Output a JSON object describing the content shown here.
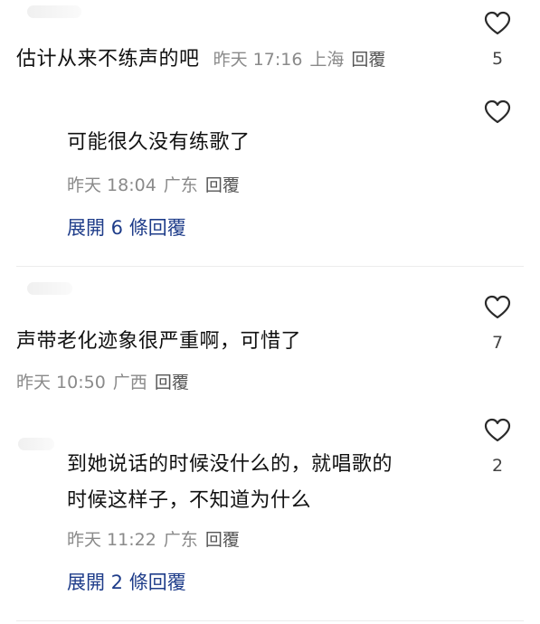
{
  "comments": [
    {
      "text": "估计从来不练声的吧",
      "date": "昨天 17:16",
      "location": "上海",
      "reply_label": "回覆",
      "likes": "5"
    },
    {
      "text": "可能很久没有练歌了",
      "date": "昨天 18:04",
      "location": "广东",
      "reply_label": "回覆",
      "expand_label": "展開 6 條回覆"
    },
    {
      "text": "声带老化迹象很严重啊，可惜了",
      "date": "昨天 10:50",
      "location": "广西",
      "reply_label": "回覆",
      "likes": "7"
    },
    {
      "text_line1": "到她说话的时候没什么的，就唱歌的",
      "text_line2": "时候这样子，不知道为什么",
      "date": "昨天 11:22",
      "location": "广东",
      "reply_label": "回覆",
      "likes": "2",
      "expand_label": "展開 2 條回覆"
    }
  ],
  "colors": {
    "expand": "#1f3d8a",
    "meta": "#8a8a8a",
    "heart_stroke": "#2a2a2a"
  },
  "icons": {
    "like": "heart-outline-icon"
  }
}
